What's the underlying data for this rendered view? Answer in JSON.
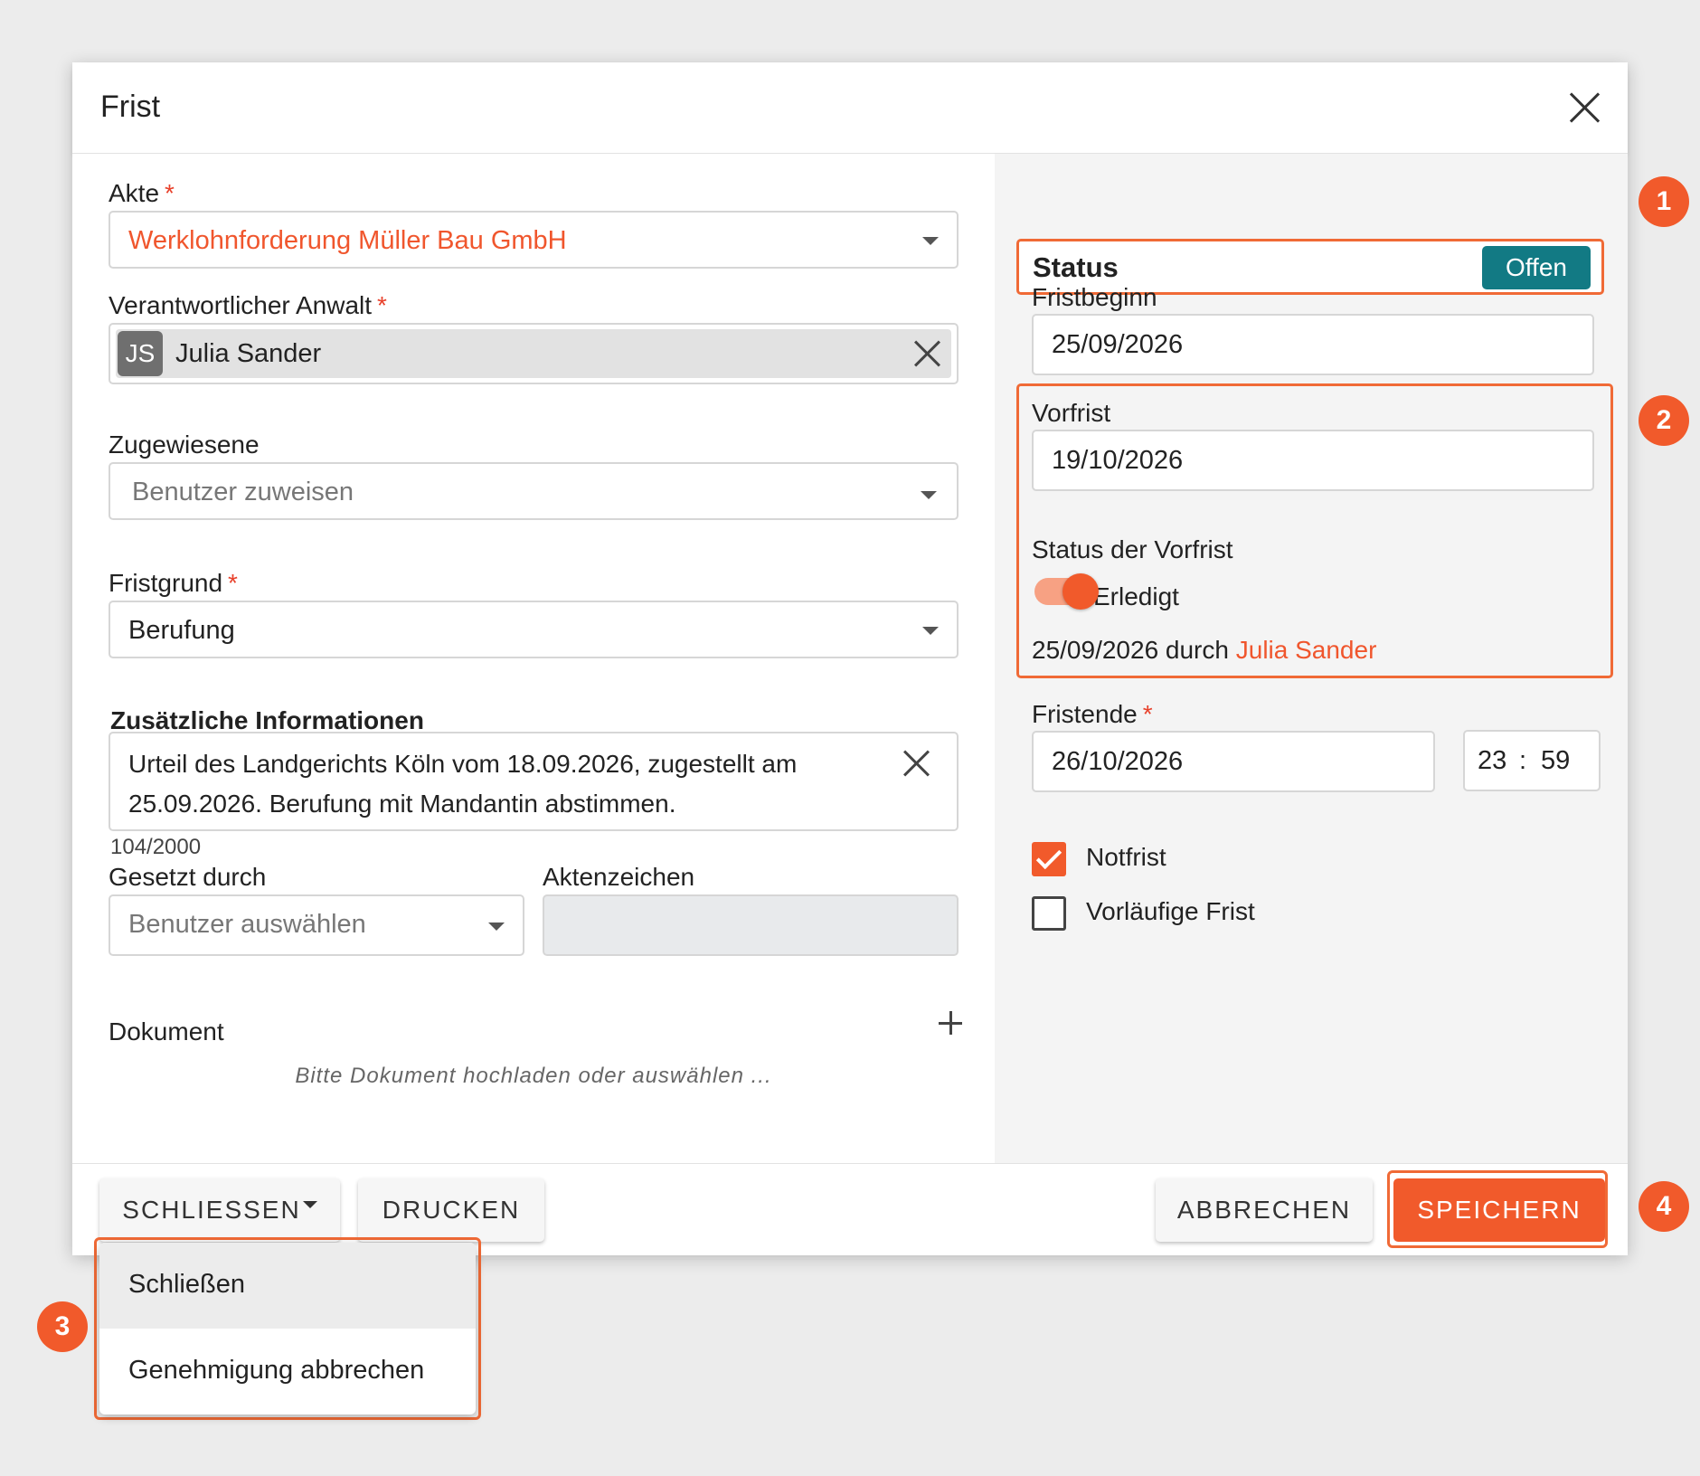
{
  "dialog": {
    "title": "Frist",
    "close_icon": "close-icon"
  },
  "left": {
    "akte": {
      "label": "Akte",
      "required": "*",
      "value": "Werklohnforderung Müller Bau GmbH"
    },
    "anwalt": {
      "label": "Verantwortlicher Anwalt",
      "required": "*",
      "initials": "JS",
      "name": "Julia Sander"
    },
    "zugewiesene": {
      "label": "Zugewiesene",
      "placeholder": "Benutzer zuweisen"
    },
    "fristgrund": {
      "label": "Fristgrund",
      "required": "*",
      "value": "Berufung"
    },
    "info": {
      "label": "Zusätzliche Informationen",
      "value": "Urteil des Landgerichts Köln vom 18.09.2026, zugestellt am 25.09.2026. Berufung mit Mandantin abstimmen.",
      "counter": "104/2000"
    },
    "gesetzt": {
      "label": "Gesetzt durch",
      "placeholder": "Benutzer auswählen"
    },
    "aktenzeichen": {
      "label": "Aktenzeichen",
      "value": ""
    },
    "dokument": {
      "label": "Dokument",
      "hint": "Bitte Dokument hochladen oder auswählen ..."
    }
  },
  "right": {
    "status": {
      "label": "Status",
      "badge": "Offen"
    },
    "fristbeginn": {
      "label": "Fristbeginn",
      "value": "25/09/2026"
    },
    "vorfrist": {
      "label": "Vorfrist",
      "value": "19/10/2026"
    },
    "vorfrist_status": {
      "label": "Status der Vorfrist",
      "toggle_label": "Erledigt",
      "toggle_on": true,
      "done_info": "25/09/2026 durch",
      "done_by": "Julia Sander"
    },
    "fristende": {
      "label": "Fristende",
      "required": "*",
      "date": "26/10/2026",
      "hour": "23",
      "sep": ":",
      "minute": "59"
    },
    "notfrist": {
      "label": "Notfrist",
      "checked": true
    },
    "vorlaeufig": {
      "label": "Vorläufige Frist",
      "checked": false
    }
  },
  "footer": {
    "schliessen": "SCHLIESSEN",
    "drucken": "DRUCKEN",
    "abbrechen": "ABBRECHEN",
    "speichern": "SPEICHERN"
  },
  "dropdown_menu": {
    "items": [
      "Schließen",
      "Genehmigung abbrechen"
    ]
  },
  "markers": [
    "1",
    "2",
    "3",
    "4"
  ],
  "colors": {
    "accent": "#f15a2b",
    "status_badge": "#127a84",
    "highlight_border": "#f06a36"
  }
}
